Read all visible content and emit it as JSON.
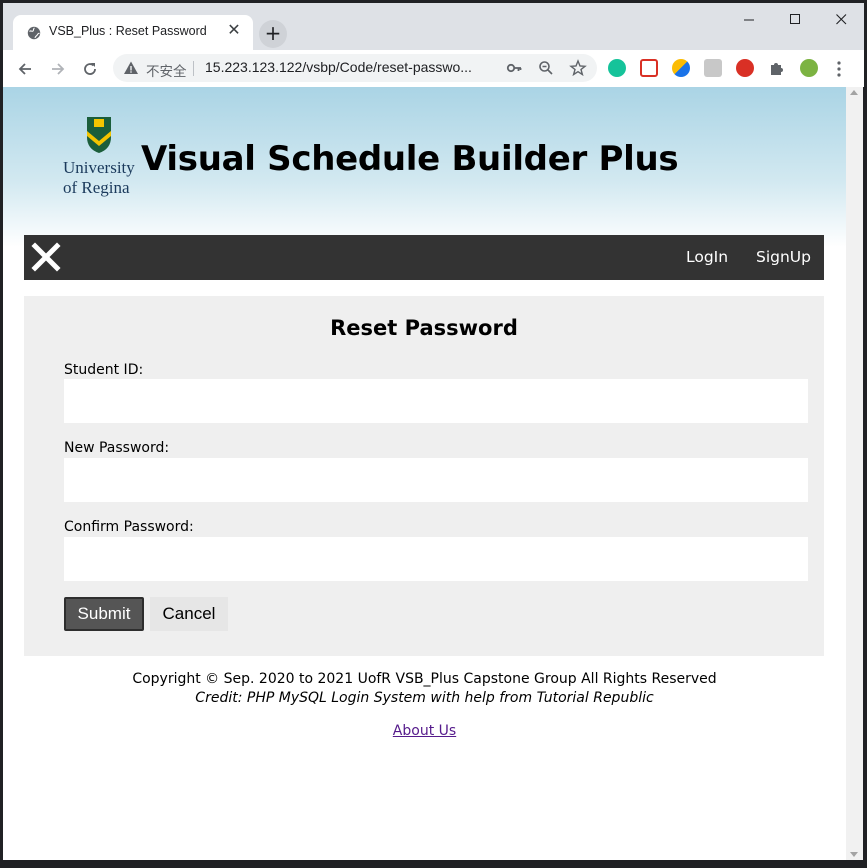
{
  "browser": {
    "tab_title": "VSB_Plus : Reset Password",
    "insecure_label": "不安全",
    "url": "15.223.123.122/vsbp/Code/reset-passwo...",
    "new_tab": "+",
    "close_tab": "✕"
  },
  "header": {
    "logo_text_line1": "University",
    "logo_text_line2": "of Regina",
    "site_title": "Visual Schedule Builder Plus"
  },
  "navbar": {
    "login": "LogIn",
    "signup": "SignUp"
  },
  "form": {
    "title": "Reset Password",
    "student_id_label": "Student ID:",
    "student_id_value": "",
    "new_password_label": "New Password:",
    "new_password_value": "",
    "confirm_password_label": "Confirm Password:",
    "confirm_password_value": "",
    "submit_label": "Submit",
    "cancel_label": "Cancel"
  },
  "footer": {
    "copyright": "Copyright © Sep. 2020 to 2021 UofR VSB_Plus Capstone Group All Rights Reserved",
    "credit": "Credit: PHP MySQL Login System with help from Tutorial Republic",
    "about_link": "About Us"
  },
  "colors": {
    "navbar_bg": "#333333",
    "card_bg": "#efefef",
    "header_gradient_top": "#aad4e5",
    "submit_bg": "#555555",
    "visited_link": "#551a8b"
  }
}
